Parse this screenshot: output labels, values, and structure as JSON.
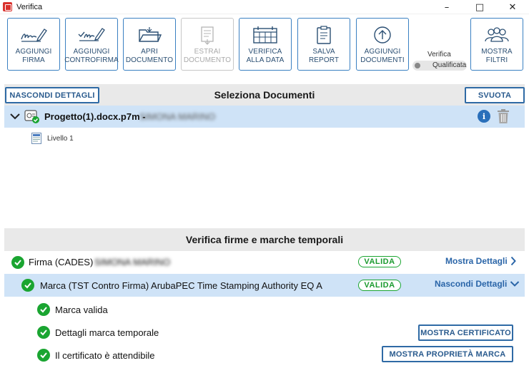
{
  "window": {
    "title": "Verifica"
  },
  "toolbar": {
    "buttons": [
      {
        "label": "AGGIUNGI FIRMA",
        "icon": "signature-pen-icon"
      },
      {
        "label": "AGGIUNGI CONTROFIRMA",
        "icon": "countersign-pen-icon"
      },
      {
        "label": "APRI DOCUMENTO",
        "icon": "open-folder-icon"
      },
      {
        "label": "ESTRAI DOCUMENTO",
        "icon": "extract-document-icon",
        "disabled": true
      },
      {
        "label": "VERIFICA ALLA DATA",
        "icon": "calendar-icon"
      },
      {
        "label": "SALVA REPORT",
        "icon": "report-icon"
      },
      {
        "label": "AGGIUNGI DOCUMENTI",
        "icon": "upload-circle-icon"
      },
      {
        "label": "MOSTRA FILTRI",
        "icon": "users-filter-icon"
      }
    ],
    "verifica_label": "Verifica",
    "toggle_label": "Qualificata"
  },
  "documents": {
    "title": "Seleziona Documenti",
    "hide_details": "NASCONDI DETTAGLI",
    "clear": "SVUOTA",
    "items": [
      {
        "name": "Progetto(1).docx.p7m -",
        "signer": "SIMONA MARINO",
        "level": "Livello 1"
      }
    ]
  },
  "verification": {
    "title": "Verifica firme e marche temporali",
    "rows": [
      {
        "label": "Firma (CADES)",
        "signer": "SIMONA MARINO",
        "status": "VALIDA",
        "link": "Mostra Dettagli"
      },
      {
        "label": "Marca (TST Contro Firma) ArubaPEC Time Stamping Authority EQ A",
        "status": "VALIDA",
        "link": "Nascondi Dettagli"
      }
    ],
    "details": [
      {
        "label": "Marca valida"
      },
      {
        "label": "Dettagli marca temporale",
        "button": "MOSTRA CERTIFICATO"
      },
      {
        "label": "Il certificato è attendibile",
        "button": "MOSTRA PROPRIETÀ MARCA"
      }
    ]
  },
  "colors": {
    "accent": "#2f6aa5",
    "selected_row": "#cfe3f7",
    "valid": "#1aa531",
    "header_bg": "#e9e9e9"
  }
}
